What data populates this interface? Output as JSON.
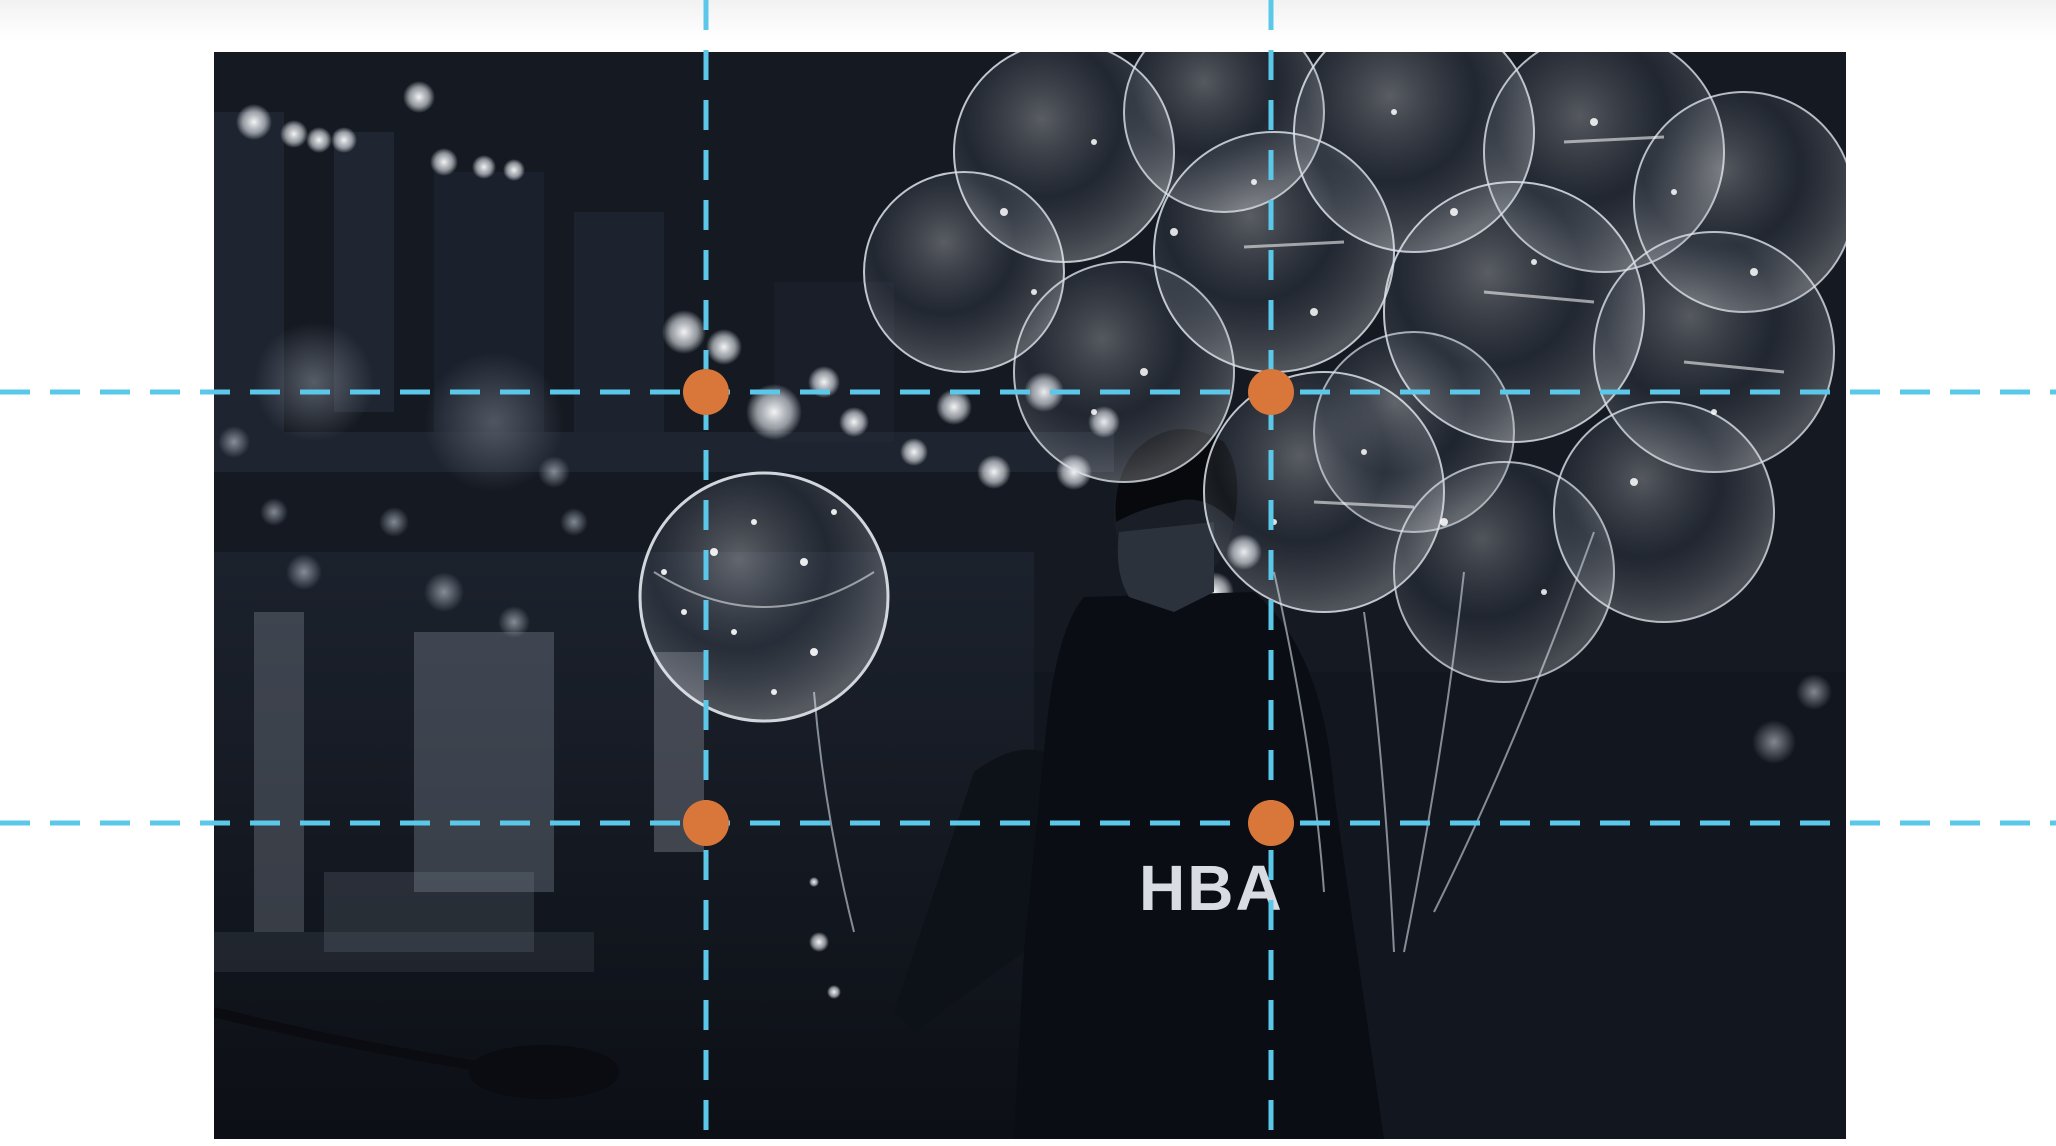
{
  "image": {
    "subject": "man-with-balloons-night",
    "jacket_lettering": "HBA"
  },
  "guides": {
    "line_color": "#5bc8ea",
    "point_color": "#d9773a",
    "vertical_lines": 2,
    "horizontal_lines": 2,
    "intersection_points": 4
  }
}
